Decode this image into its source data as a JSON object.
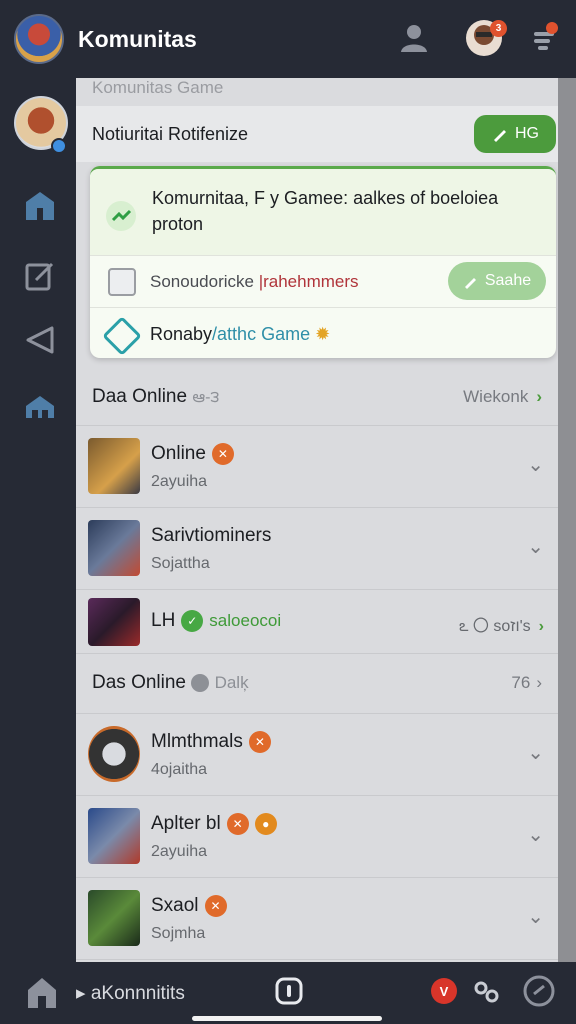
{
  "header": {
    "title": "Komunitas",
    "message_badge": "3"
  },
  "panel": {
    "heading": "Komunitas Game",
    "notif_title": "Notiuritai Rotifenize",
    "hs_button": "HG"
  },
  "card": {
    "message": "Komurnitaa, F y Gamee: aalkes of boeloiea proton",
    "input_prefix": "Sonoudoricke ",
    "input_highlight": "|rahehmmers",
    "search_button": "Saahe",
    "game_prefix": "Ronaby",
    "game_highlight": "/atthc Game"
  },
  "sections": [
    {
      "label": "Daa Online",
      "label_extra": "ఆ-౩",
      "right": "Wiekonk"
    },
    {
      "label": "Das Online",
      "label_extra": "Dalķ",
      "right": "76"
    }
  ],
  "items": [
    {
      "name": "Online",
      "sub": "2ayuiha"
    },
    {
      "name": "Sarivtiominers",
      "sub": "Sojattha"
    },
    {
      "name": "LH",
      "status": "saloeocoi",
      "right": "ఽ 〇 soוז's"
    },
    {
      "name": "Mlmthmals",
      "sub": "4ojaitha"
    },
    {
      "name": "Aplter bl",
      "sub": "2ayuiha"
    },
    {
      "name": "Sxaol",
      "sub": "Sojmha"
    }
  ],
  "bottom": {
    "title": "aKonnnitits",
    "notif_badge": "V"
  }
}
